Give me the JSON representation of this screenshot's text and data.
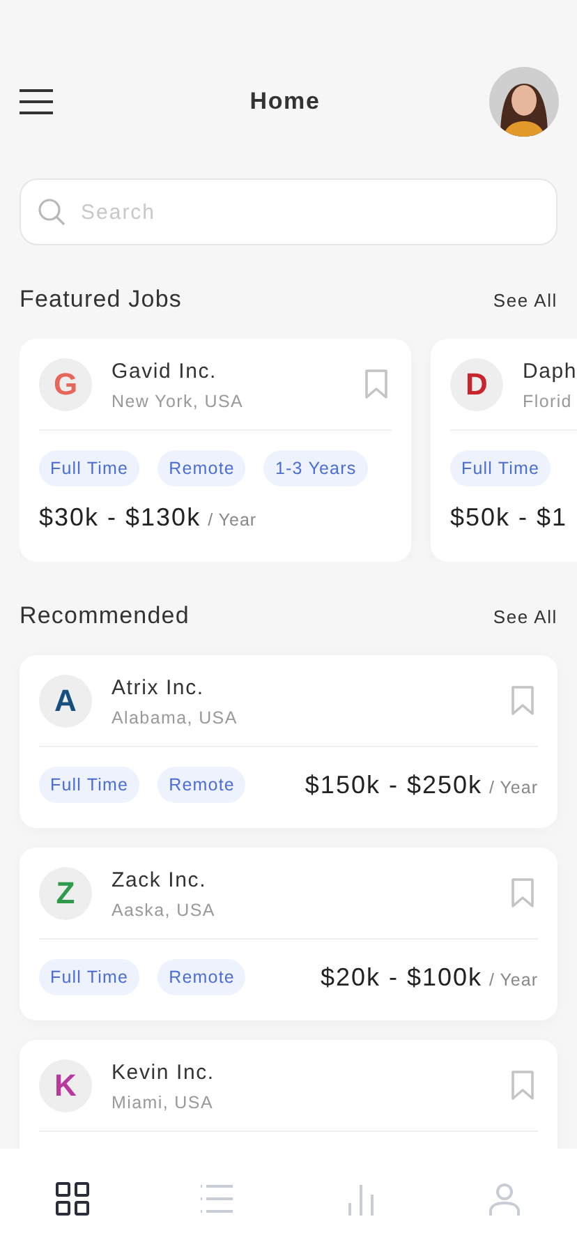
{
  "header": {
    "title": "Home"
  },
  "search": {
    "placeholder": "Search"
  },
  "featured": {
    "title": "Featured Jobs",
    "link": "See All",
    "jobs": [
      {
        "logo": "G",
        "color": "#e8655a",
        "company": "Gavid Inc.",
        "location": "New York, USA",
        "saved": false,
        "tags": [
          "Full Time",
          "Remote",
          "1-3 Years"
        ],
        "salary": "$30k - $130k",
        "period": "/ Year"
      },
      {
        "logo": "D",
        "color": "#c9252c",
        "company": "Daph",
        "location": "Florid",
        "tags": [
          "Full Time"
        ],
        "salary": "$50k - $1"
      }
    ]
  },
  "recommended": {
    "title": "Recommended",
    "link": "See All",
    "jobs": [
      {
        "logo": "A",
        "color": "#17507f",
        "company": "Atrix Inc.",
        "location": "Alabama, USA",
        "saved": false,
        "tags": [
          "Full Time",
          "Remote"
        ],
        "salary": "$150k - $250k",
        "period": "/ Year"
      },
      {
        "logo": "Z",
        "color": "#2f9a4a",
        "company": "Zack Inc.",
        "location": "Aaska, USA",
        "saved": false,
        "tags": [
          "Full Time",
          "Remote"
        ],
        "salary": "$20k - $100k",
        "period": "/ Year"
      },
      {
        "logo": "K",
        "color": "#b8389c",
        "company": "Kevin Inc.",
        "location": "Miami, USA",
        "saved": false
      }
    ]
  },
  "nav": [
    {
      "kind": "grid",
      "selected": true
    },
    {
      "kind": "list",
      "selected": false
    },
    {
      "kind": "chart",
      "selected": false
    },
    {
      "kind": "profile",
      "selected": false
    }
  ]
}
